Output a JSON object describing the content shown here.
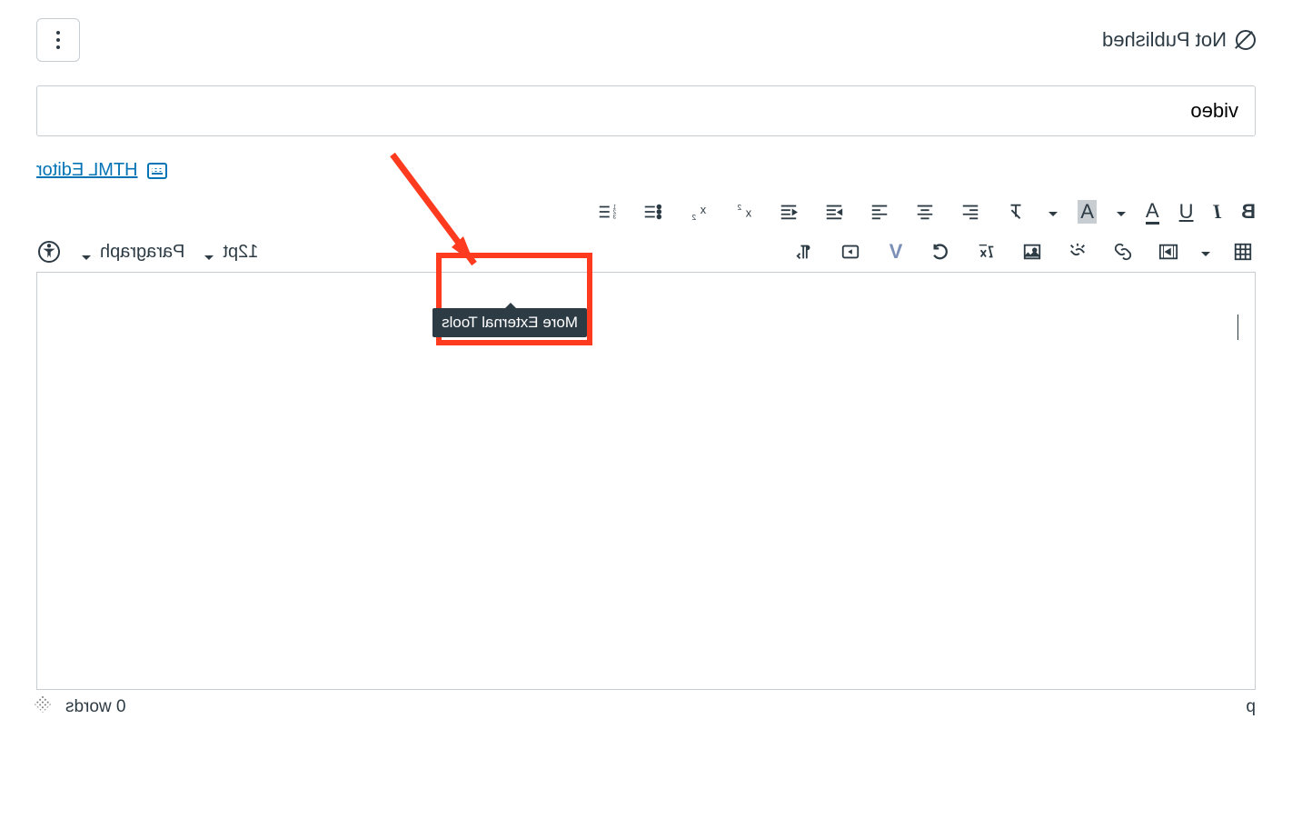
{
  "header": {
    "status_label": "Not Published"
  },
  "title_field": {
    "value": "video"
  },
  "editor_switch": {
    "link_label": "HTML Editor"
  },
  "toolbar": {
    "row1": {
      "bold": "B",
      "italic": "I",
      "underline": "U",
      "textcolor": "A",
      "highlight": "A",
      "clearformat_label": "clear-format"
    },
    "row2": {
      "font_size_label": "12pt",
      "paragraph_label": "Paragraph",
      "v_label": "V"
    },
    "tooltip": "More External Tools"
  },
  "statusbar": {
    "path": "p",
    "wordcount": "0 words"
  }
}
